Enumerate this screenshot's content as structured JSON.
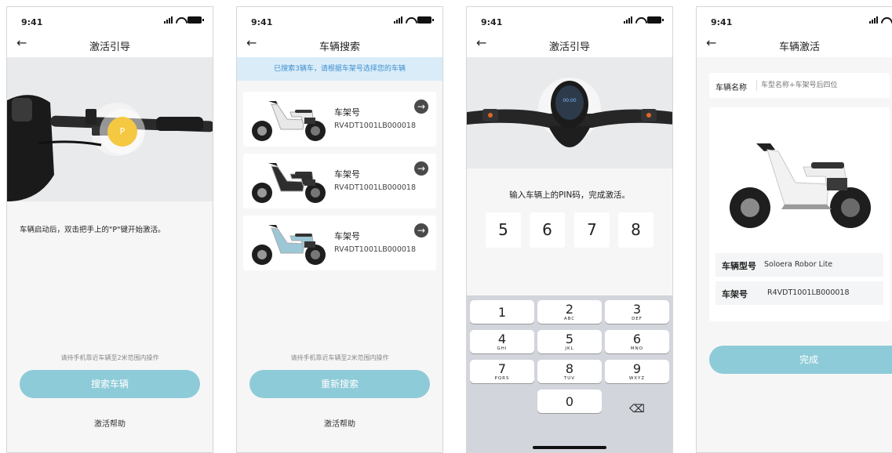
{
  "status": {
    "time": "9:41"
  },
  "screen1": {
    "title": "激活引导",
    "button_label": "P",
    "instruction": "车辆启动后，双击把手上的\"P\"键开始激活。",
    "hint": "请持手机靠近车辆至2米范围内操作",
    "primary_button": "搜索车辆",
    "help": "激活帮助"
  },
  "screen2": {
    "title": "车辆搜索",
    "banner": "已搜索3辆车，请根据车架号选择您的车辆",
    "vehicles": [
      {
        "label": "车架号",
        "frame_no": "RV4DT1001LB000018",
        "color": "#e8e8e8"
      },
      {
        "label": "车架号",
        "frame_no": "RV4DT1001LB000018",
        "color": "#2e2e2e"
      },
      {
        "label": "车架号",
        "frame_no": "RV4DT1001LB000018",
        "color": "#9cc7d6"
      }
    ],
    "hint": "请持手机靠近车辆至2米范围内操作",
    "primary_button": "重新搜索",
    "help": "激活帮助"
  },
  "screen3": {
    "title": "激活引导",
    "display": "00:00",
    "instruction": "输入车辆上的PIN码，完成激活。",
    "pin": [
      "5",
      "6",
      "7",
      "8"
    ],
    "keys": [
      {
        "digit": "1",
        "letters": ""
      },
      {
        "digit": "2",
        "letters": "ABC"
      },
      {
        "digit": "3",
        "letters": "DEF"
      },
      {
        "digit": "4",
        "letters": "GHI"
      },
      {
        "digit": "5",
        "letters": "JKL"
      },
      {
        "digit": "6",
        "letters": "MNO"
      },
      {
        "digit": "7",
        "letters": "PQRS"
      },
      {
        "digit": "8",
        "letters": "TUV"
      },
      {
        "digit": "9",
        "letters": "WXYZ"
      },
      {
        "digit": "0",
        "letters": ""
      }
    ],
    "delete_symbol": "⌫"
  },
  "screen4": {
    "title": "车辆激活",
    "name_label": "车辆名称",
    "name_placeholder": "车型名称+车架号后四位",
    "model_label": "车辆型号",
    "model_value": "Soloera Robor Lite",
    "frame_label": "车架号",
    "frame_value": "R4VDT1001LB000018",
    "done_button": "完成"
  },
  "colors": {
    "accent": "#8ecbd8",
    "banner_bg": "#d9ecf8",
    "banner_text": "#3f8fd0",
    "p_button": "#f5c842"
  }
}
